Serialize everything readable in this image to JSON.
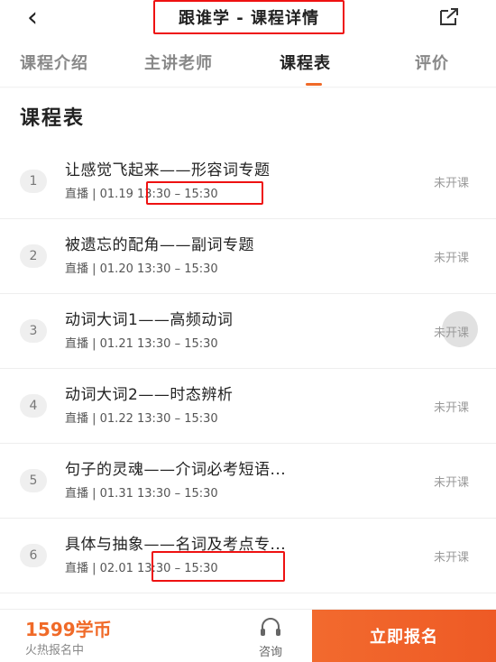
{
  "header": {
    "back_icon": "chevron-left-icon",
    "title": "跟谁学 - 课程详情",
    "share_icon": "share-icon"
  },
  "tabs": [
    {
      "label": "课程介绍"
    },
    {
      "label": "主讲老师"
    },
    {
      "label": "课程表",
      "active": true
    },
    {
      "label": "评价"
    }
  ],
  "section_title": "课程表",
  "lessons": [
    {
      "num": "1",
      "title": "让感觉飞起来——形容词专题",
      "meta": "直播 | 01.19 13:30 – 15:30",
      "status": "未开课"
    },
    {
      "num": "2",
      "title": "被遗忘的配角——副词专题",
      "meta": "直播 | 01.20 13:30 – 15:30",
      "status": "未开课"
    },
    {
      "num": "3",
      "title": "动词大词1——高频动词",
      "meta": "直播 | 01.21 13:30 – 15:30",
      "status": "未开课"
    },
    {
      "num": "4",
      "title": "动词大词2——时态辨析",
      "meta": "直播 | 01.22 13:30 – 15:30",
      "status": "未开课"
    },
    {
      "num": "5",
      "title": "句子的灵魂——介词必考短语...",
      "meta": "直播 | 01.31 13:30 – 15:30",
      "status": "未开课"
    },
    {
      "num": "6",
      "title": "具体与抽象——名词及考点专...",
      "meta": "直播 | 02.01 13:30 – 15:30",
      "status": "未开课"
    }
  ],
  "footer": {
    "price": "1599学币",
    "hot_text": "火热报名中",
    "consult_icon": "headset-icon",
    "consult_label": "咨询",
    "cta_label": "立即报名"
  },
  "colors": {
    "accent": "#f06a28",
    "highlight_box": "#ee1111"
  }
}
